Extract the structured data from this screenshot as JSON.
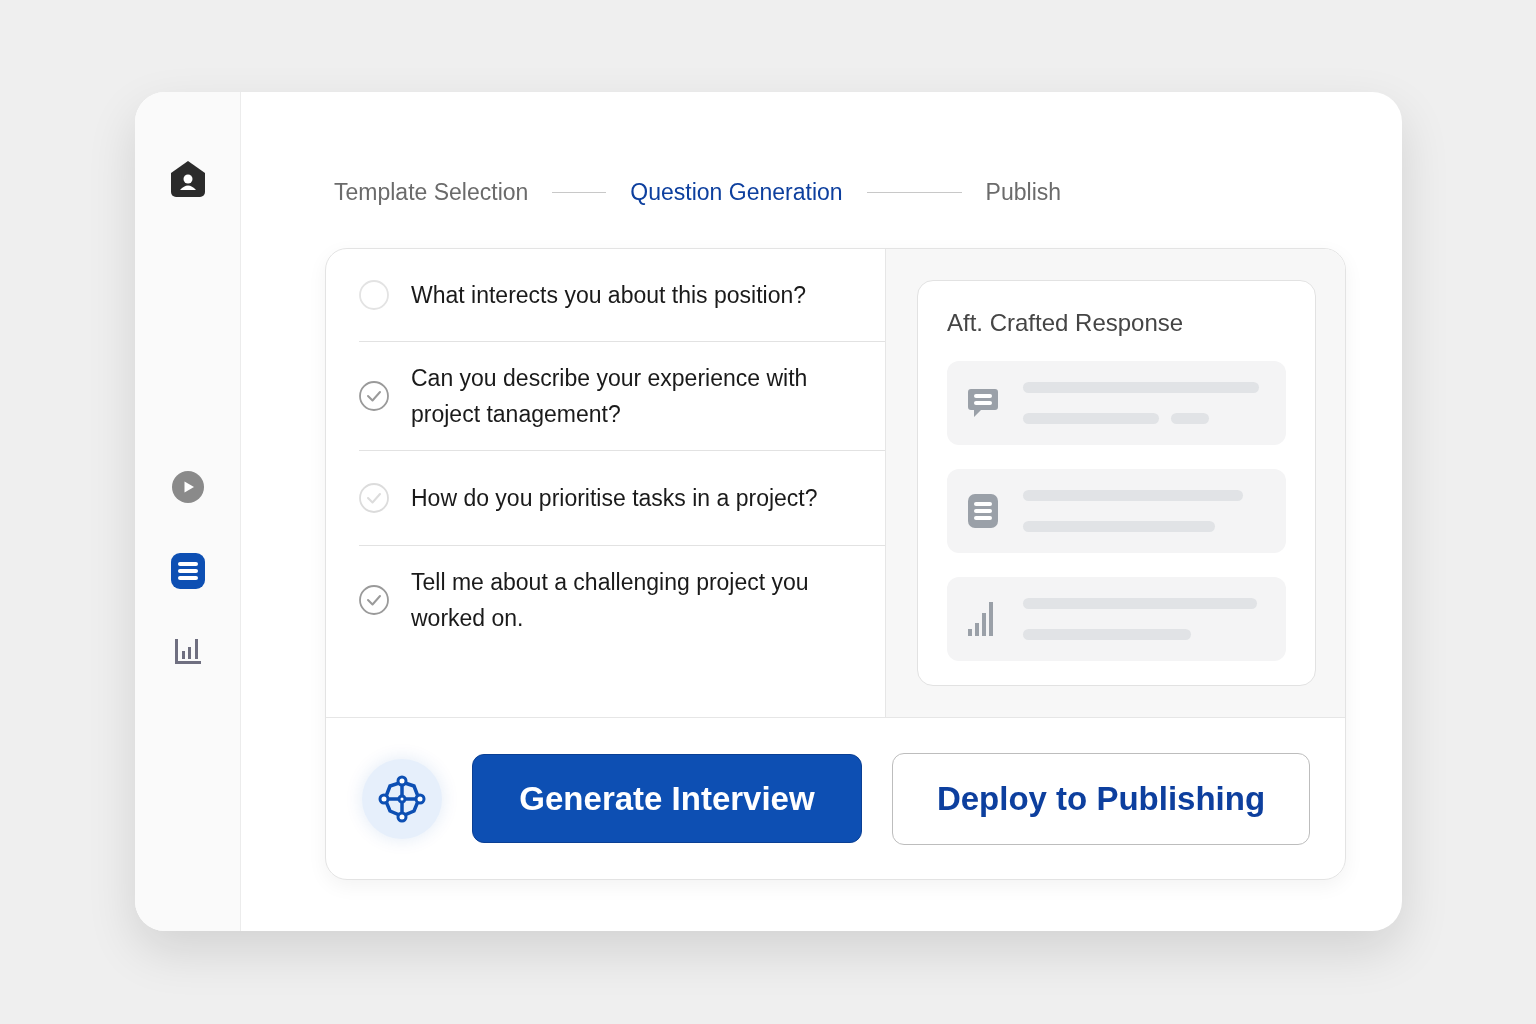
{
  "sidebar": {
    "items": [
      {
        "kind": "profile",
        "selected": false
      },
      {
        "kind": "play",
        "selected": false
      },
      {
        "kind": "list",
        "selected": true
      },
      {
        "kind": "chart",
        "selected": false
      }
    ]
  },
  "steps": [
    {
      "label": "Template Selection",
      "selected": false
    },
    {
      "label": "Question Generation",
      "selected": true
    },
    {
      "label": "Publish",
      "selected": false
    }
  ],
  "questions": [
    {
      "text": "What interects you about this position?",
      "checked": false,
      "faded": false
    },
    {
      "text": "Can you describe your experience with project tanagement?",
      "checked": true,
      "faded": false
    },
    {
      "text": "How do you prioritise tasks in a project?",
      "checked": true,
      "faded": true
    },
    {
      "text": "Tell me about a challenging project you worked on.",
      "checked": true,
      "faded": false
    }
  ],
  "response_card": {
    "title": "Aft. Crafted Response",
    "items": [
      {
        "kind": "chat"
      },
      {
        "kind": "list"
      },
      {
        "kind": "chart"
      }
    ]
  },
  "actions": {
    "primary": "Generate Interview",
    "secondary": "Deploy to Publishing"
  }
}
